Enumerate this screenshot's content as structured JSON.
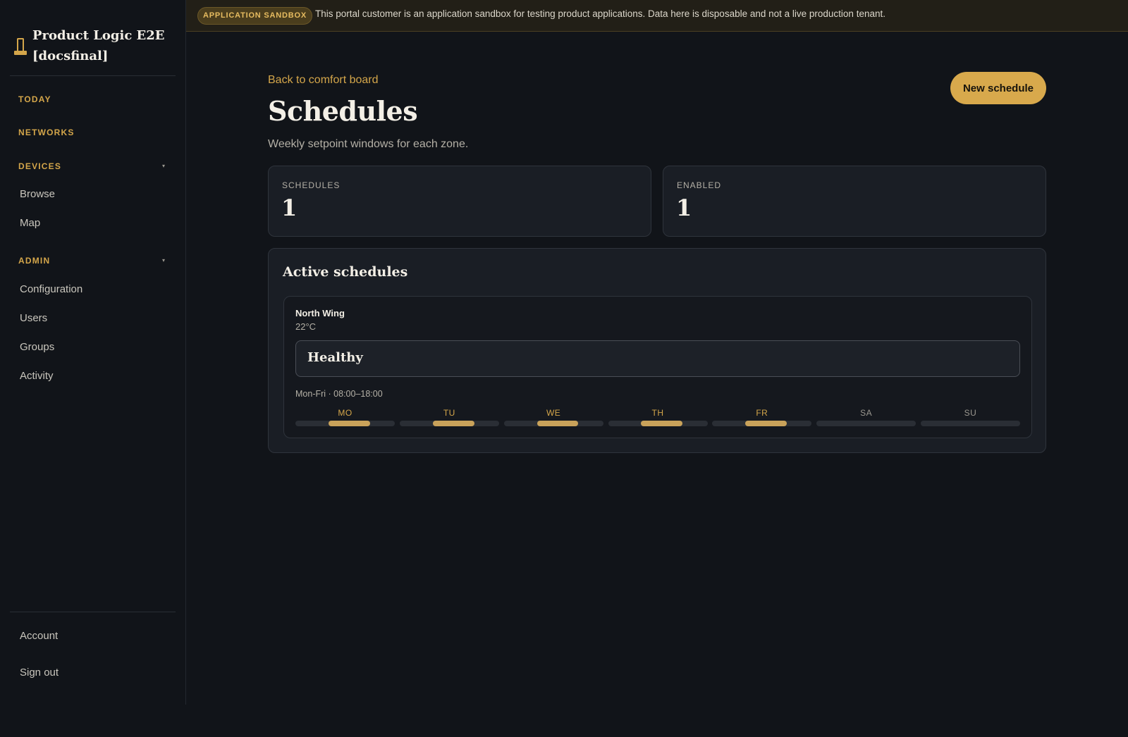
{
  "brand": {
    "title": "Product Logic E2E [docsfinal]",
    "icon": "pole-icon"
  },
  "nav": {
    "today": "TODAY",
    "networks": "NETWORKS",
    "devices": {
      "label": "DEVICES",
      "caret": "▾",
      "items": [
        "Browse",
        "Map"
      ]
    },
    "admin": {
      "label": "ADMIN",
      "caret": "▾",
      "items": [
        "Configuration",
        "Users",
        "Groups",
        "Activity"
      ]
    },
    "footer": [
      "Account",
      "Sign out"
    ]
  },
  "banner": {
    "badge": "APPLICATION SANDBOX",
    "text": "This portal customer is an application sandbox for testing product applications. Data here is disposable and not a live production tenant."
  },
  "page": {
    "back_link": "Back to comfort board",
    "title": "Schedules",
    "subtitle": "Weekly setpoint windows for each zone.",
    "new_button": "New schedule"
  },
  "stats": [
    {
      "label": "SCHEDULES",
      "value": "1"
    },
    {
      "label": "ENABLED",
      "value": "1"
    }
  ],
  "panel": {
    "title": "Active schedules",
    "schedule": {
      "zone": "North Wing",
      "setpoint": "22°C",
      "status": "Healthy",
      "window": "Mon-Fri · 08:00–18:00",
      "days": [
        {
          "label": "MO",
          "active": true,
          "start_fraction": 0.333,
          "end_fraction": 0.75
        },
        {
          "label": "TU",
          "active": true,
          "start_fraction": 0.333,
          "end_fraction": 0.75
        },
        {
          "label": "WE",
          "active": true,
          "start_fraction": 0.333,
          "end_fraction": 0.75
        },
        {
          "label": "TH",
          "active": true,
          "start_fraction": 0.333,
          "end_fraction": 0.75
        },
        {
          "label": "FR",
          "active": true,
          "start_fraction": 0.333,
          "end_fraction": 0.75
        },
        {
          "label": "SA",
          "active": false
        },
        {
          "label": "SU",
          "active": false
        }
      ]
    }
  },
  "colors": {
    "accent": "#d4a64a",
    "background": "#111419",
    "card": "#1a1e25",
    "banner": "#221f17"
  }
}
